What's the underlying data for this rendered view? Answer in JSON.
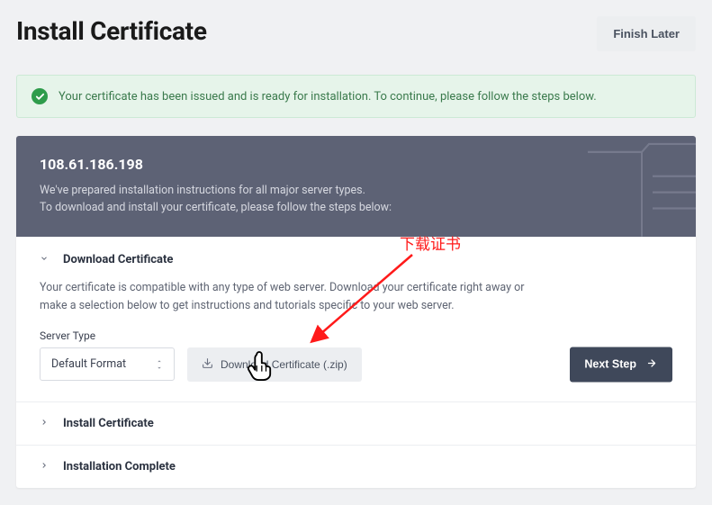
{
  "header": {
    "title": "Install Certificate",
    "finish_later": "Finish Later"
  },
  "alert": {
    "text": "Your certificate has been issued and is ready for installation. To continue, please follow the steps below."
  },
  "instructions": {
    "ip": "108.61.186.198",
    "line1": "We've prepared installation instructions for all major server types.",
    "line2": "To download and install your certificate, please follow the steps below:"
  },
  "steps": {
    "download": {
      "title": "Download Certificate",
      "body": "Your certificate is compatible with any type of web server. Download your certificate right away or make a selection below to get instructions and tutorials specific to your web server.",
      "server_type_label": "Server Type",
      "server_type_value": "Default Format",
      "download_button": "Download Certificate (.zip)",
      "next_step": "Next Step"
    },
    "install": {
      "title": "Install Certificate"
    },
    "complete": {
      "title": "Installation Complete"
    }
  },
  "annotation": {
    "text": "下载证书"
  }
}
